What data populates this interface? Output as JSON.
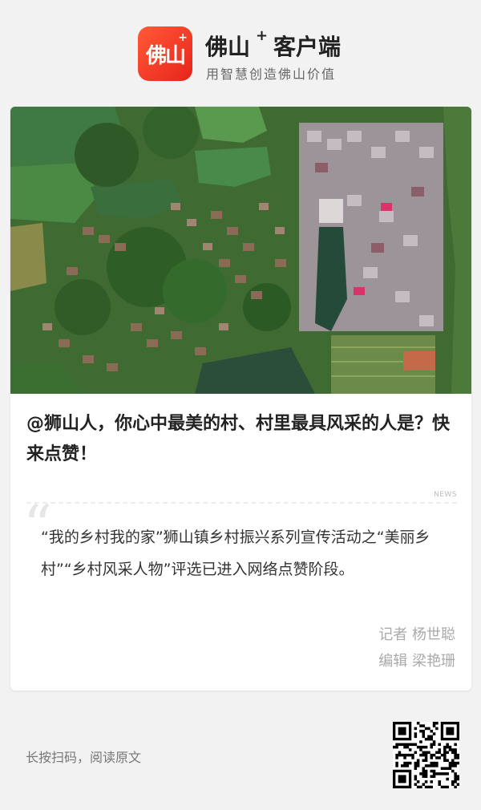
{
  "header": {
    "logo_text": "佛山",
    "logo_plus": "+",
    "brand_name": "佛山",
    "brand_sup": "+",
    "brand_suffix": "客户端",
    "slogan": "用智慧创造佛山价值"
  },
  "article": {
    "headline": "@狮山人，你心中最美的村、村里最具风采的人是？快来点赞！",
    "news_tag": "NEWS",
    "quote_mark": "“",
    "summary": "“我的乡村我的家”狮山镇乡村振兴系列宣传活动之“美丽乡村”“乡村风采人物”评选已进入网络点赞阶段。",
    "reporter": "记者 杨世聪",
    "editor": "编辑 梁艳珊"
  },
  "footer": {
    "hint": "长按扫码，阅读原文"
  },
  "icons": {
    "logo": "foshan-app-logo",
    "qr": "qr-code-icon"
  },
  "colors": {
    "logo_gradient_start": "#ff5a36",
    "logo_gradient_end": "#e8241c",
    "background": "#f2f2f2"
  }
}
